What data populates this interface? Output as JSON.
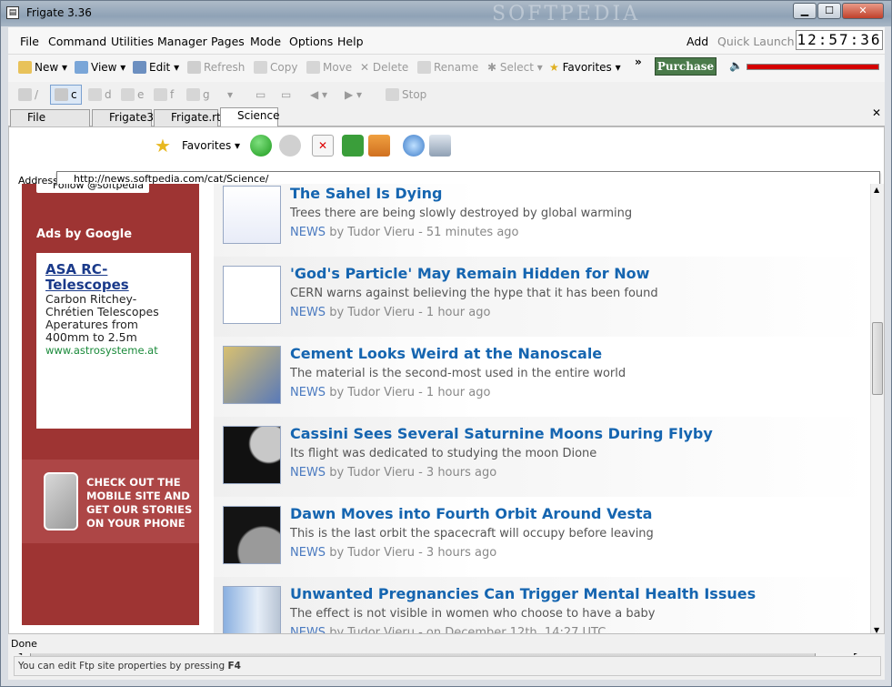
{
  "window": {
    "title": "Frigate 3.36",
    "watermark": "SOFTPEDIA",
    "minimize": "▁",
    "maximize": "☐",
    "close": "✕"
  },
  "menu": {
    "items": [
      "File",
      "Command",
      "Utilities",
      "Manager",
      "Pages",
      "Mode",
      "Options",
      "Help"
    ],
    "add": "Add",
    "quick_launch": "Quick Launch",
    "clock": "12:57:36"
  },
  "toolbar1": {
    "new": "New",
    "view": "View",
    "edit": "Edit",
    "refresh": "Refresh",
    "copy": "Copy",
    "move": "Move",
    "delete": "Delete",
    "rename": "Rename",
    "select": "Select",
    "favorites": "Favorites",
    "more": "»",
    "purchase": "Purchase"
  },
  "toolbar2": {
    "drives": [
      "/",
      "c",
      "d",
      "e",
      "f",
      "g"
    ],
    "stop": "Stop"
  },
  "tabs": [
    "File Manager",
    "Frigate3",
    "Frigate.rtf",
    "Science"
  ],
  "browser": {
    "favorites": "Favorites",
    "address_label": "Address",
    "address": "http://news.softpedia.com/cat/Science/"
  },
  "sidebar": {
    "follow": "Follow @softpedia",
    "ads_by": "Ads by Google",
    "ad_title": "ASA RC-Telescopes",
    "ad_text": "Carbon Ritchey-Chrétien Telescopes Aperatures from 400mm to 2.5m",
    "ad_url": "www.astrosysteme.at",
    "mobile_text": "CHECK OUT THE MOBILE SITE AND GET OUR STORIES ON YOUR PHONE"
  },
  "articles": [
    {
      "title": "The Sahel Is Dying",
      "desc": "Trees there are being slowly destroyed by global warming",
      "tag": "NEWS",
      "meta": "by Tudor Vieru - 51 minutes ago"
    },
    {
      "title": "'God's Particle' May Remain Hidden for Now",
      "desc": "CERN warns against believing the hype that it has been found",
      "tag": "NEWS",
      "meta": "by Tudor Vieru - 1 hour ago"
    },
    {
      "title": "Cement Looks Weird at the Nanoscale",
      "desc": "The material is the second-most used in the entire world",
      "tag": "NEWS",
      "meta": "by Tudor Vieru - 1 hour ago"
    },
    {
      "title": "Cassini Sees Several Saturnine Moons During Flyby",
      "desc": "Its flight was dedicated to studying the moon Dione",
      "tag": "NEWS",
      "meta": "by Tudor Vieru - 3 hours ago"
    },
    {
      "title": "Dawn Moves into Fourth Orbit Around Vesta",
      "desc": "This is the last orbit the spacecraft will occupy before leaving",
      "tag": "NEWS",
      "meta": "by Tudor Vieru - 3 hours ago"
    },
    {
      "title": "Unwanted Pregnancies Can Trigger Mental Health Issues",
      "desc": "The effect is not visible in women who choose to have a baby",
      "tag": "NEWS",
      "meta": "by Tudor Vieru - on December 12th, 14:27 UTC"
    }
  ],
  "status": "Done",
  "hint": {
    "text": "You can edit Ftp site properties by pressing",
    "key": "F4"
  },
  "colors": {
    "sidebar": "#9e3433",
    "link": "#1565b0",
    "purchase": "#4a7a4a",
    "volume": "#d40000"
  }
}
